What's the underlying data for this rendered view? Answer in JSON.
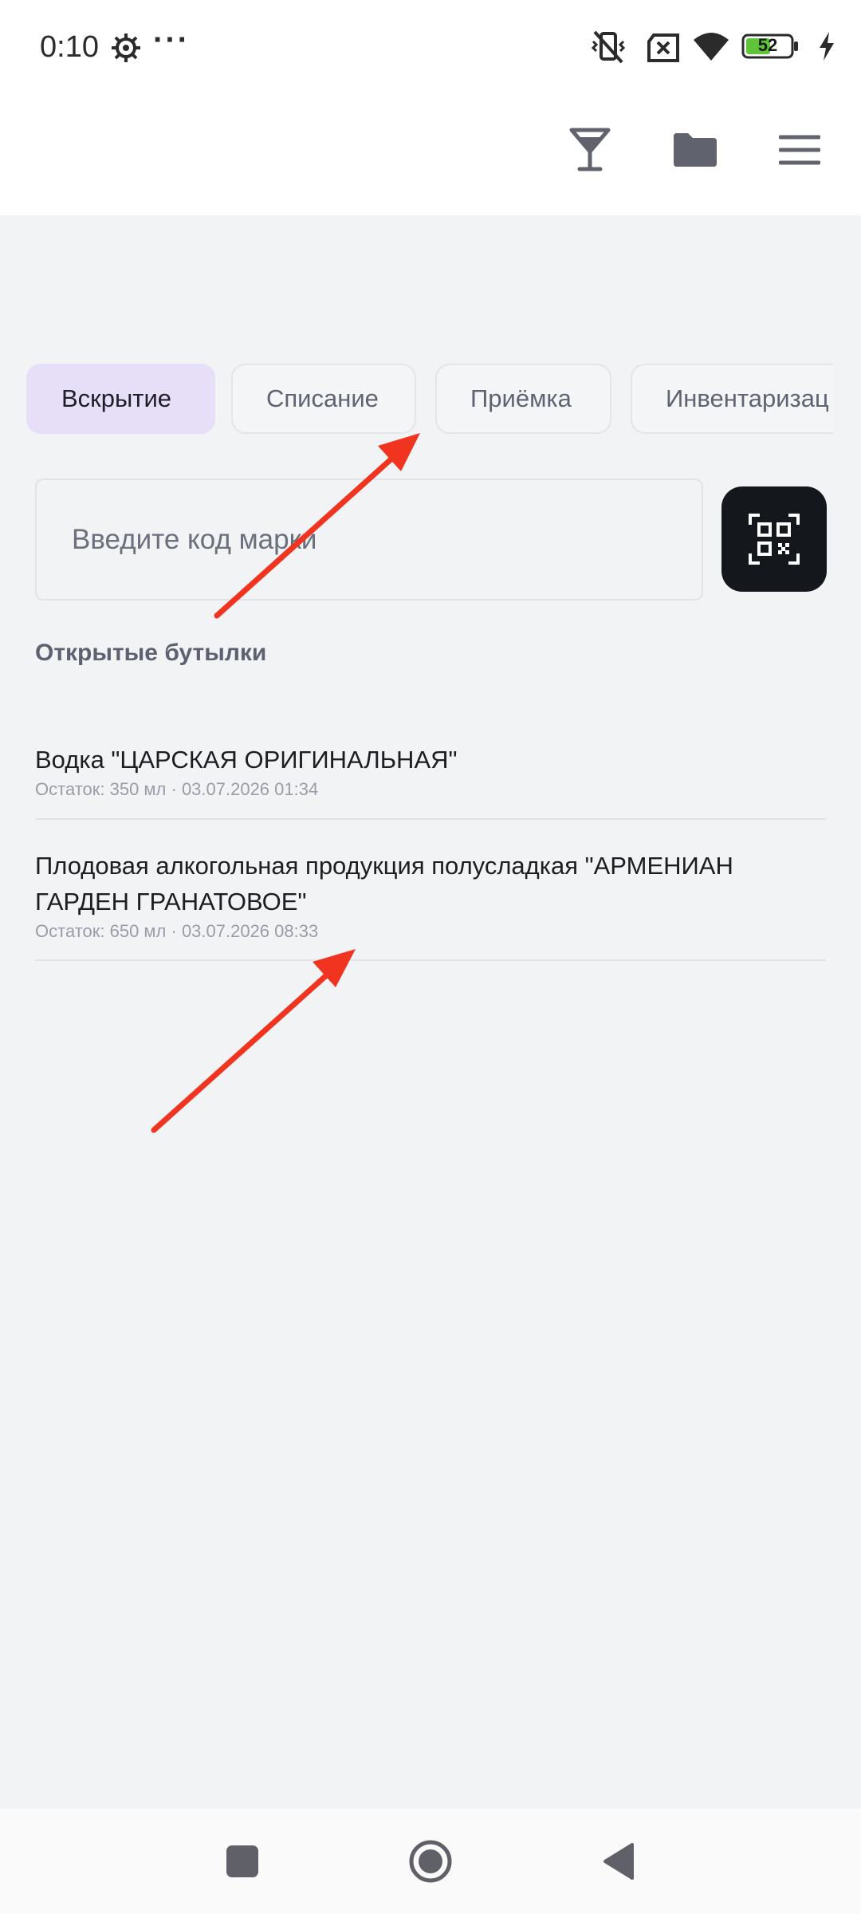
{
  "status_bar": {
    "time": "0:10",
    "more": "···",
    "battery": "52",
    "icons": [
      "gear-icon",
      "vibrate-off-icon",
      "no-sim-icon",
      "wifi-icon",
      "battery-icon",
      "charging-icon"
    ]
  },
  "app_bar": {
    "icons": [
      "glass-icon",
      "folder-icon",
      "menu-icon"
    ]
  },
  "tabs": [
    {
      "label": "Вскрытие",
      "active": true
    },
    {
      "label": "Списание",
      "active": false
    },
    {
      "label": "Приёмка",
      "active": false
    },
    {
      "label": "Инвентаризац",
      "active": false
    }
  ],
  "search": {
    "placeholder": "Введите код марки",
    "value": ""
  },
  "section_title": "Открытые бутылки",
  "bottles": [
    {
      "name": "Водка \"ЦАРСКАЯ ОРИГИНАЛЬНАЯ\"",
      "meta": "Остаток: 350 мл · 03.07.2026 01:34"
    },
    {
      "name": "Плодовая алкогольная продукция полусладкая \"АРМЕНИАН ГАРДЕН ГРАНАТОВОЕ\"",
      "meta": "Остаток: 650 мл · 03.07.2026 08:33"
    }
  ],
  "colors": {
    "accent_tab": "#e6dff7",
    "scan_button": "#14171c",
    "annotation_arrow": "#f03420"
  }
}
